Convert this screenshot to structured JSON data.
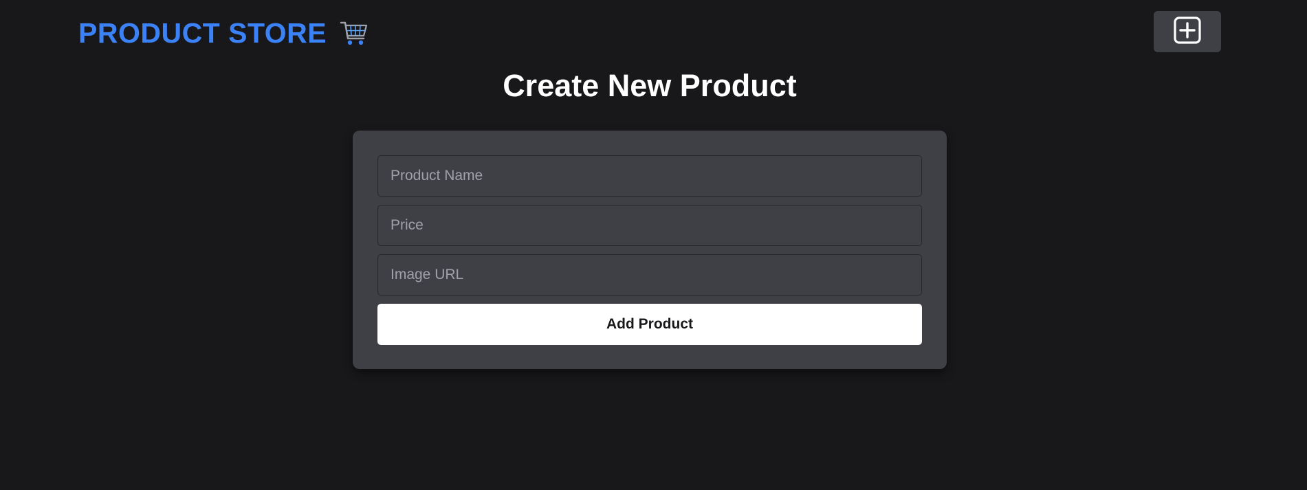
{
  "navbar": {
    "brand_text": "PRODUCT STORE",
    "brand_icon": "shopping-cart-icon",
    "create_button_icon": "plus-square-icon",
    "brand_color": "#3b82f6"
  },
  "main": {
    "title": "Create New Product"
  },
  "form": {
    "name_placeholder": "Product Name",
    "name_value": "",
    "price_placeholder": "Price",
    "price_value": "",
    "image_placeholder": "Image URL",
    "image_value": "",
    "submit_label": "Add Product"
  },
  "colors": {
    "background": "#18181b",
    "card": "#3f3f46",
    "submit_button": "#ffffff"
  }
}
